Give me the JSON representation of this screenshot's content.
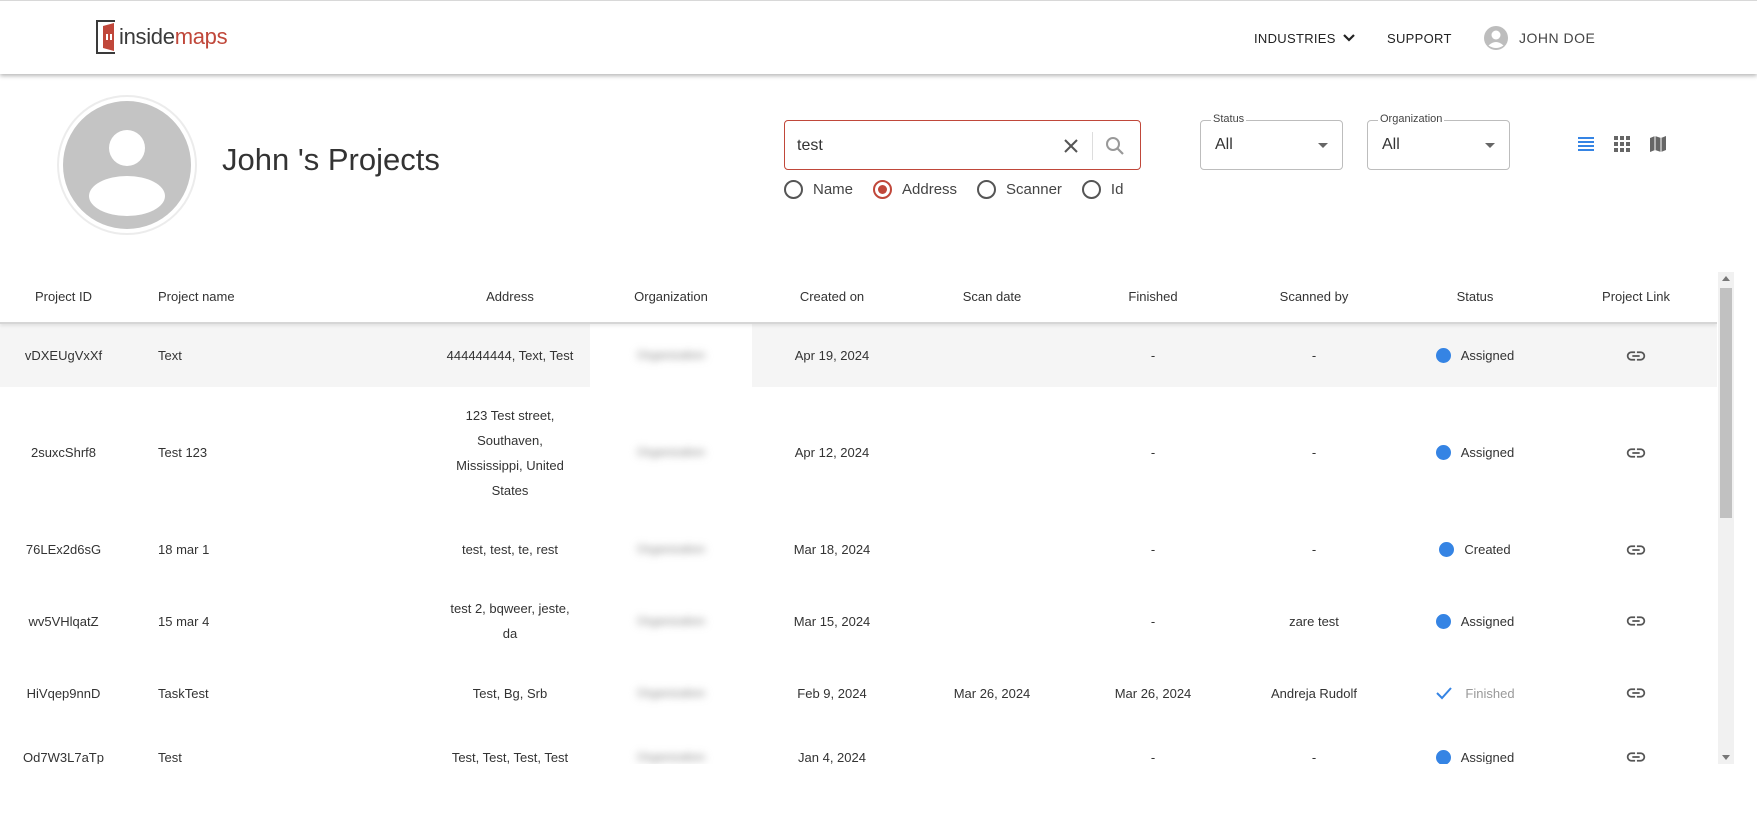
{
  "header": {
    "logo": {
      "part1": "inside",
      "part2": "maps"
    },
    "nav": {
      "industries": "INDUSTRIES",
      "support": "SUPPORT",
      "user": "JOHN DOE"
    }
  },
  "profile": {
    "title": "John 's Projects"
  },
  "search": {
    "value": "test",
    "options": [
      {
        "label": "Name",
        "selected": false
      },
      {
        "label": "Address",
        "selected": true
      },
      {
        "label": "Scanner",
        "selected": false
      },
      {
        "label": "Id",
        "selected": false
      }
    ]
  },
  "filters": {
    "status": {
      "label": "Status",
      "value": "All"
    },
    "organization": {
      "label": "Organization",
      "value": "All"
    }
  },
  "table": {
    "columns": [
      "Project ID",
      "Project name",
      "Address",
      "Organization",
      "Created on",
      "Scan date",
      "Finished",
      "Scanned by",
      "Status",
      "Project Link"
    ],
    "rows": [
      {
        "id": "vDXEUgVxXf",
        "name": "Text",
        "address": [
          "444444444, Text, Test"
        ],
        "org": "Organization",
        "created": "Apr 19, 2024",
        "scan": "",
        "finished": "-",
        "scanned_by": "-",
        "status": "Assigned"
      },
      {
        "id": "2suxcShrf8",
        "name": "Test 123",
        "address": [
          "123 Test street,",
          "Southaven,",
          "Mississippi, United",
          "States"
        ],
        "org": "Organization",
        "created": "Apr 12, 2024",
        "scan": "",
        "finished": "-",
        "scanned_by": "-",
        "status": "Assigned"
      },
      {
        "id": "76LEx2d6sG",
        "name": "18 mar 1",
        "address": [
          "test, test, te, rest"
        ],
        "org": "Organization",
        "created": "Mar 18, 2024",
        "scan": "",
        "finished": "-",
        "scanned_by": "-",
        "status": "Created"
      },
      {
        "id": "wv5VHlqatZ",
        "name": "15 mar 4",
        "address": [
          "test 2, bqweer, jeste,",
          "da"
        ],
        "org": "Organization",
        "created": "Mar 15, 2024",
        "scan": "",
        "finished": "-",
        "scanned_by": "zare test",
        "status": "Assigned"
      },
      {
        "id": "HiVqep9nnD",
        "name": "TaskTest",
        "address": [
          "Test, Bg, Srb"
        ],
        "org": "Organization",
        "created": "Feb 9, 2024",
        "scan": "Mar 26, 2024",
        "finished": "Mar 26, 2024",
        "scanned_by": "Andreja Rudolf",
        "status": "Finished"
      },
      {
        "id": "Od7W3L7aTp",
        "name": "Test",
        "address": [
          "Test, Test, Test, Test"
        ],
        "org": "Organization",
        "created": "Jan 4, 2024",
        "scan": "",
        "finished": "-",
        "scanned_by": "-",
        "status": "Assigned"
      }
    ]
  },
  "colors": {
    "accent": "#c0473a",
    "status_dot": "#3584e4"
  }
}
